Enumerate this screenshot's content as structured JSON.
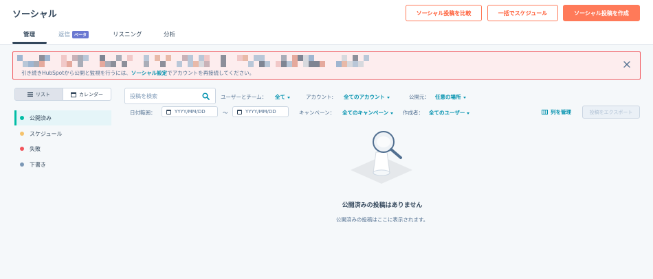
{
  "page": {
    "title": "ソーシャル"
  },
  "header": {
    "compare_label": "ソーシャル投稿を比較",
    "bulk_schedule_label": "一括でスケジュール",
    "create_label": "ソーシャル投稿を作成"
  },
  "tabs": [
    {
      "label": "管理"
    },
    {
      "label": "返信",
      "badge": "ベータ"
    },
    {
      "label": "リスニング"
    },
    {
      "label": "分析"
    }
  ],
  "banner": {
    "text_before": "引き続きHubSpotから公開と監視を行うには、",
    "link": "ソーシャル設定",
    "text_after": "でアカウントを再接続してください。"
  },
  "view_toggle": {
    "list_label": "リスト",
    "calendar_label": "カレンダー"
  },
  "sidebar": {
    "items": [
      {
        "label": "公開済み",
        "color": "#00bda5"
      },
      {
        "label": "スケジュール",
        "color": "#f5c26b"
      },
      {
        "label": "失敗",
        "color": "#f2545b"
      },
      {
        "label": "下書き",
        "color": "#7c98b6"
      }
    ]
  },
  "filters": {
    "search_placeholder": "投稿を検索",
    "users_label": "ユーザーとチーム：",
    "users_value": "全て",
    "account_label": "アカウント:",
    "account_value": "全てのアカウント",
    "publish_label": "公開元：",
    "publish_value": "任意の場所",
    "date_label": "日付範囲：",
    "date_from": "YYYY/MM/DD",
    "date_sep": "〜",
    "date_to": "YYYY/MM/DD",
    "campaign_label": "キャンペーン：",
    "campaign_value": "全てのキャンペーン",
    "creator_label": "作成者：",
    "creator_value": "全てのユーザー",
    "manage_columns": "列を管理",
    "export": "投稿をエクスポート"
  },
  "empty_state": {
    "title": "公開済みの投稿はありません",
    "subtitle": "公開済みの投稿はここに表示されます。"
  },
  "colors": {
    "accent": "#ff7a59",
    "link": "#0091ae",
    "banner_bg": "#fdedee",
    "banner_border": "#f2545b"
  }
}
